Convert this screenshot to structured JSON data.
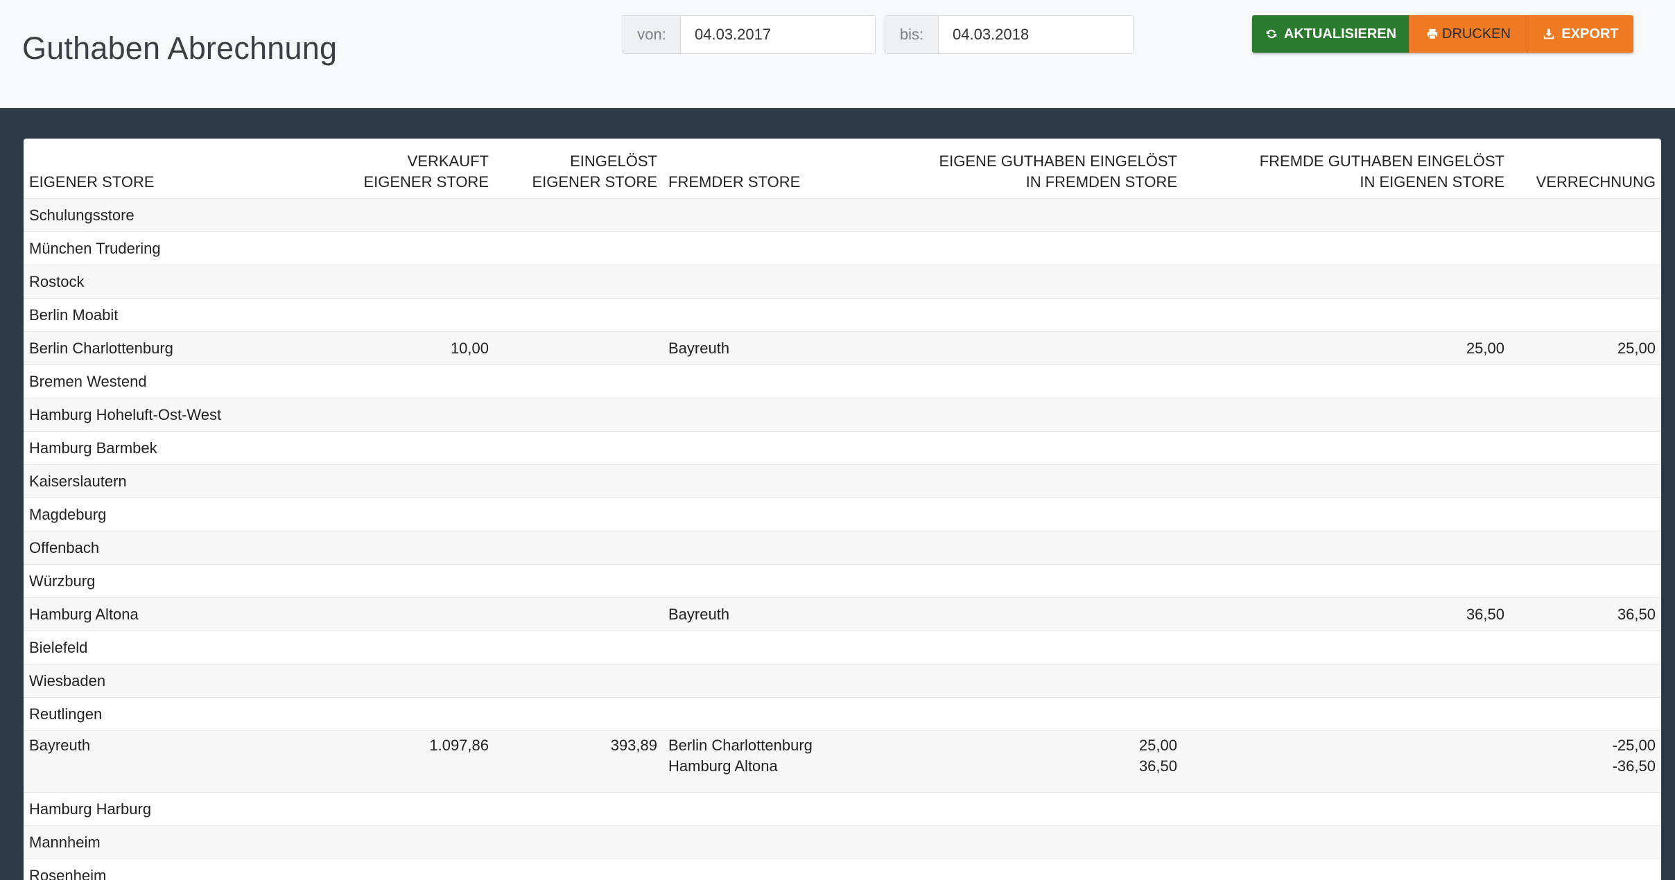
{
  "header": {
    "title": "Guthaben Abrechnung",
    "from_label": "von:",
    "from_value": "04.03.2017",
    "to_label": "bis:",
    "to_value": "04.03.2018"
  },
  "toolbar": {
    "update_label": "AKTUALISIEREN",
    "print_label": "DRUCKEN",
    "export_label": "EXPORT"
  },
  "colors": {
    "update": "#2a7a2b",
    "print": "#ee7b23",
    "export": "#ee7b23",
    "backdrop": "#2e3a47"
  },
  "icons": {
    "update": "refresh-icon",
    "print": "printer-icon",
    "export": "download-icon"
  },
  "table": {
    "headers": {
      "own_store": "EIGENER STORE",
      "sold_l1": "VERKAUFT",
      "sold_l2": "EIGENER STORE",
      "redeemed_l1": "EINGELÖST",
      "redeemed_l2": "EIGENER STORE",
      "foreign_store": "FREMDER STORE",
      "own_in_foreign_l1": "EIGENE GUTHABEN EINGELÖST",
      "own_in_foreign_l2": "IN FREMDEN STORE",
      "foreign_in_own_l1": "FREMDE GUTHABEN EINGELÖST",
      "foreign_in_own_l2": "IN EIGENEN STORE",
      "settlement": "VERRECHNUNG"
    },
    "rows": [
      {
        "store": "Schulungsstore",
        "sold": "",
        "redeemed": "",
        "foreign": [
          "",
          ""
        ],
        "own_in_foreign": [
          "",
          ""
        ],
        "foreign_in_own": "",
        "settlement": [
          "",
          ""
        ]
      },
      {
        "store": "München Trudering",
        "sold": "",
        "redeemed": "",
        "foreign": [
          "",
          ""
        ],
        "own_in_foreign": [
          "",
          ""
        ],
        "foreign_in_own": "",
        "settlement": [
          "",
          ""
        ]
      },
      {
        "store": "Rostock",
        "sold": "",
        "redeemed": "",
        "foreign": [
          "",
          ""
        ],
        "own_in_foreign": [
          "",
          ""
        ],
        "foreign_in_own": "",
        "settlement": [
          "",
          ""
        ]
      },
      {
        "store": "Berlin Moabit",
        "sold": "",
        "redeemed": "",
        "foreign": [
          "",
          ""
        ],
        "own_in_foreign": [
          "",
          ""
        ],
        "foreign_in_own": "",
        "settlement": [
          "",
          ""
        ]
      },
      {
        "store": "Berlin Charlottenburg",
        "sold": "10,00",
        "redeemed": "",
        "foreign": [
          "Bayreuth",
          ""
        ],
        "own_in_foreign": [
          "",
          ""
        ],
        "foreign_in_own": "25,00",
        "settlement": [
          "25,00",
          ""
        ]
      },
      {
        "store": "Bremen Westend",
        "sold": "",
        "redeemed": "",
        "foreign": [
          "",
          ""
        ],
        "own_in_foreign": [
          "",
          ""
        ],
        "foreign_in_own": "",
        "settlement": [
          "",
          ""
        ]
      },
      {
        "store": "Hamburg Hoheluft-Ost-West",
        "sold": "",
        "redeemed": "",
        "foreign": [
          "",
          ""
        ],
        "own_in_foreign": [
          "",
          ""
        ],
        "foreign_in_own": "",
        "settlement": [
          "",
          ""
        ]
      },
      {
        "store": "Hamburg Barmbek",
        "sold": "",
        "redeemed": "",
        "foreign": [
          "",
          ""
        ],
        "own_in_foreign": [
          "",
          ""
        ],
        "foreign_in_own": "",
        "settlement": [
          "",
          ""
        ]
      },
      {
        "store": "Kaiserslautern",
        "sold": "",
        "redeemed": "",
        "foreign": [
          "",
          ""
        ],
        "own_in_foreign": [
          "",
          ""
        ],
        "foreign_in_own": "",
        "settlement": [
          "",
          ""
        ]
      },
      {
        "store": "Magdeburg",
        "sold": "",
        "redeemed": "",
        "foreign": [
          "",
          ""
        ],
        "own_in_foreign": [
          "",
          ""
        ],
        "foreign_in_own": "",
        "settlement": [
          "",
          ""
        ]
      },
      {
        "store": "Offenbach",
        "sold": "",
        "redeemed": "",
        "foreign": [
          "",
          ""
        ],
        "own_in_foreign": [
          "",
          ""
        ],
        "foreign_in_own": "",
        "settlement": [
          "",
          ""
        ]
      },
      {
        "store": "Würzburg",
        "sold": "",
        "redeemed": "",
        "foreign": [
          "",
          ""
        ],
        "own_in_foreign": [
          "",
          ""
        ],
        "foreign_in_own": "",
        "settlement": [
          "",
          ""
        ]
      },
      {
        "store": "Hamburg Altona",
        "sold": "",
        "redeemed": "",
        "foreign": [
          "Bayreuth",
          ""
        ],
        "own_in_foreign": [
          "",
          ""
        ],
        "foreign_in_own": "36,50",
        "settlement": [
          "36,50",
          ""
        ]
      },
      {
        "store": "Bielefeld",
        "sold": "",
        "redeemed": "",
        "foreign": [
          "",
          ""
        ],
        "own_in_foreign": [
          "",
          ""
        ],
        "foreign_in_own": "",
        "settlement": [
          "",
          ""
        ]
      },
      {
        "store": "Wiesbaden",
        "sold": "",
        "redeemed": "",
        "foreign": [
          "",
          ""
        ],
        "own_in_foreign": [
          "",
          ""
        ],
        "foreign_in_own": "",
        "settlement": [
          "",
          ""
        ]
      },
      {
        "store": "Reutlingen",
        "sold": "",
        "redeemed": "",
        "foreign": [
          "",
          ""
        ],
        "own_in_foreign": [
          "",
          ""
        ],
        "foreign_in_own": "",
        "settlement": [
          "",
          ""
        ]
      },
      {
        "store": "Bayreuth",
        "sold": "1.097,86",
        "redeemed": "393,89",
        "foreign": [
          "Berlin Charlottenburg",
          "Hamburg Altona"
        ],
        "own_in_foreign": [
          "25,00",
          "36,50"
        ],
        "foreign_in_own": "",
        "settlement": [
          "-25,00",
          "-36,50"
        ]
      },
      {
        "store": "Hamburg Harburg",
        "sold": "",
        "redeemed": "",
        "foreign": [
          "",
          ""
        ],
        "own_in_foreign": [
          "",
          ""
        ],
        "foreign_in_own": "",
        "settlement": [
          "",
          ""
        ]
      },
      {
        "store": "Mannheim",
        "sold": "",
        "redeemed": "",
        "foreign": [
          "",
          ""
        ],
        "own_in_foreign": [
          "",
          ""
        ],
        "foreign_in_own": "",
        "settlement": [
          "",
          ""
        ]
      },
      {
        "store": "Rosenheim",
        "sold": "",
        "redeemed": "",
        "foreign": [
          "",
          ""
        ],
        "own_in_foreign": [
          "",
          ""
        ],
        "foreign_in_own": "",
        "settlement": [
          "",
          ""
        ]
      }
    ]
  }
}
